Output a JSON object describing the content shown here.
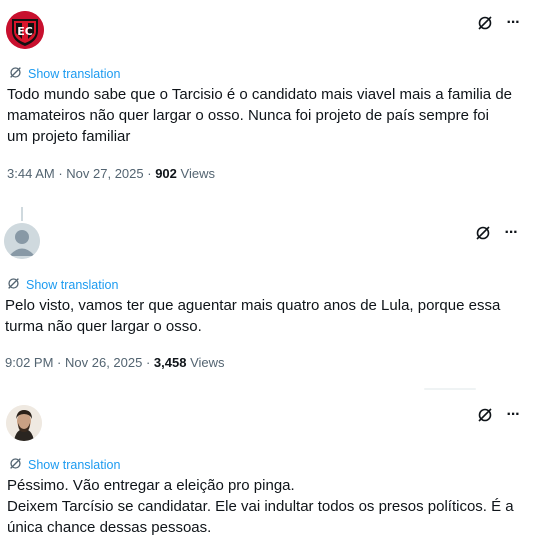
{
  "colors": {
    "link": "#1d9bf0",
    "text": "#0f1419",
    "muted": "#536471",
    "thread_line": "#cfd9de"
  },
  "icons": {
    "translate": "translate-icon",
    "no_translate": "no-translate-icon",
    "more": "more-dots-icon"
  },
  "posts": [
    {
      "avatar": "club-crest-avatar",
      "show_translation": "Show translation",
      "text": "Todo mundo sabe que o Tarcisio é o candidato mais viavel mais a familia de mamateiros não quer largar o osso. Nunca foi projeto de país sempre foi um projeto familiar",
      "time": "3:44 AM",
      "date": "Nov 27, 2025",
      "views_count": "902",
      "views_label": "Views"
    },
    {
      "avatar": "default-avatar",
      "show_translation": "Show translation",
      "text": "Pelo visto, vamos ter que aguentar mais quatro anos de Lula, porque essa turma não quer largar o osso.",
      "time": "9:02 PM",
      "date": "Nov 26, 2025",
      "views_count": "3,458",
      "views_label": "Views"
    },
    {
      "avatar": "portrait-avatar",
      "show_translation": "Show translation",
      "text_line1": "Péssimo. Vão entregar a eleição pro pinga.",
      "text_line2": "Deixem Tarcísio se candidatar. Ele vai indultar todos os presos políticos. É a única chance dessas pessoas."
    }
  ]
}
